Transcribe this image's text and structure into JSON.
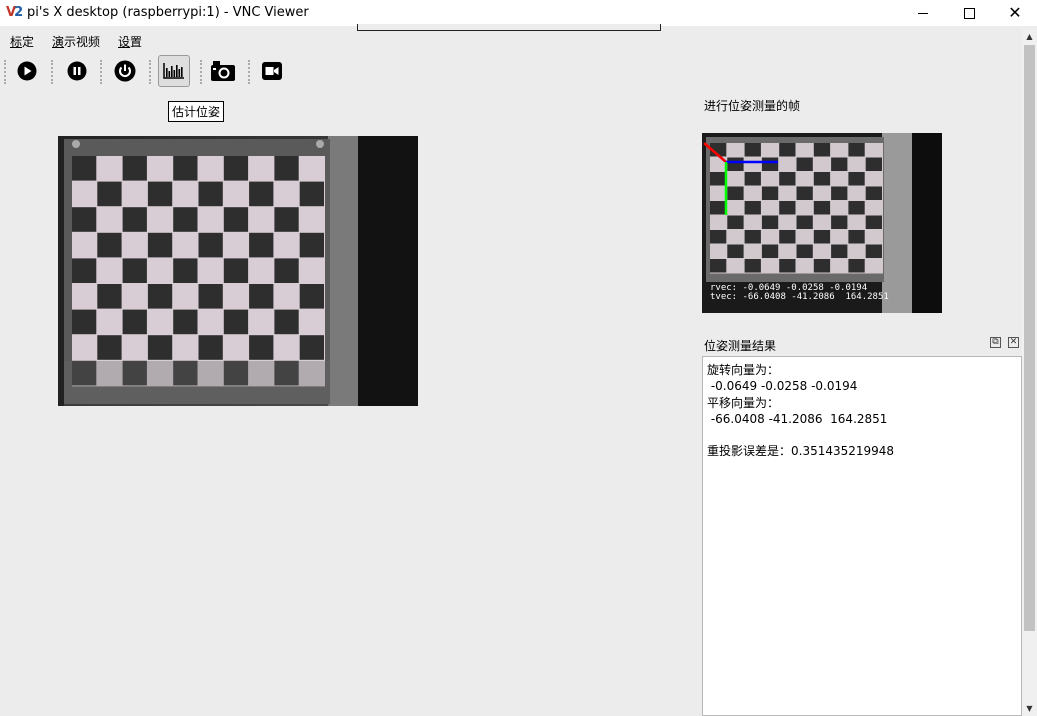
{
  "window": {
    "title": "pi's X desktop (raspberrypi:1) - VNC Viewer",
    "logo_text": "V2",
    "minimize_icon": "minimize-icon",
    "maximize_icon": "maximize-icon",
    "close_icon": "close-icon"
  },
  "menu": {
    "items": [
      "标定",
      "演示视频",
      "设置"
    ]
  },
  "toolbar": {
    "buttons": [
      "play-icon",
      "pause-icon",
      "power-icon",
      "pose-estimate-icon",
      "camera-icon",
      "video-icon"
    ],
    "tooltip": "估计位姿"
  },
  "frame_panel": {
    "label": "进行位姿测量的帧",
    "overlay_rvec": "rvec: -0.0649 -0.0258 -0.0194",
    "overlay_tvec": "tvec: -66.0408 -41.2086  164.2851",
    "axis_colors": {
      "x": "#0000ff",
      "y": "#00ff00",
      "z": "#ff0000"
    }
  },
  "result_panel": {
    "title": "位姿测量结果",
    "float_icon": "float-icon",
    "close_icon": "close-icon",
    "lines": [
      "旋转向量为：",
      " -0.0649 -0.0258 -0.0194",
      "平移向量为：",
      " -66.0408 -41.2086  164.2851",
      "",
      "重投影误差是：0.351435219948"
    ]
  }
}
